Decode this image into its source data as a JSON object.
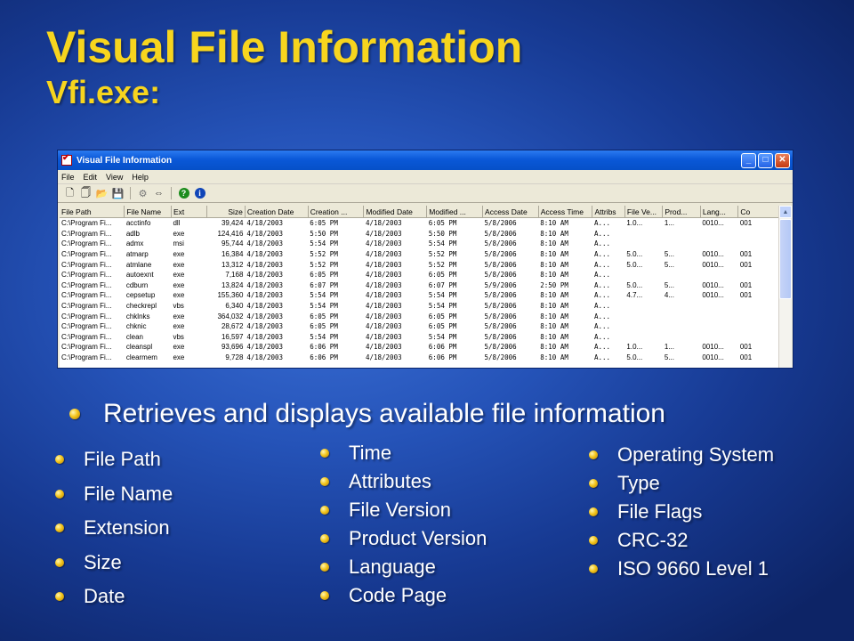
{
  "slide": {
    "title": "Visual File Information",
    "subtitle": "Vfi.exe:",
    "title_color": "#f7d51e",
    "main_bullet": "Retrieves and displays available file information",
    "bullets_col1": [
      "File Path",
      "File Name",
      "Extension",
      "Size",
      "Date"
    ],
    "bullets_col2": [
      "Time",
      "Attributes",
      "File Version",
      "Product Version",
      "Language",
      "Code Page"
    ],
    "bullets_col3": [
      "Operating System",
      "Type",
      "File Flags",
      "CRC-32",
      "ISO 9660 Level 1"
    ]
  },
  "window": {
    "title": "Visual File Information",
    "menu": [
      "File",
      "Edit",
      "View",
      "Help"
    ],
    "toolbar_icons": [
      "new-icon",
      "copy-icon",
      "open-icon",
      "save-icon",
      "tools-icon",
      "columns-icon",
      "help-icon",
      "info-icon"
    ],
    "columns": [
      "File Path",
      "File Name",
      "Ext",
      "Size",
      "Creation Date",
      "Creation ...",
      "Modified Date",
      "Modified ...",
      "Access Date",
      "Access Time",
      "Attribs",
      "File Ve...",
      "Prod...",
      "Lang...",
      "Co"
    ],
    "rows": [
      [
        "C:\\Program Fi...",
        "acctinfo",
        "dll",
        "39,424",
        "4/18/2003",
        "6:05 PM",
        "4/18/2003",
        "6:05 PM",
        "5/8/2006",
        "8:10 AM",
        "A...",
        "1.0...",
        "1...",
        "0010...",
        "001"
      ],
      [
        "C:\\Program Fi...",
        "adlb",
        "exe",
        "124,416",
        "4/18/2003",
        "5:50 PM",
        "4/18/2003",
        "5:50 PM",
        "5/8/2006",
        "8:10 AM",
        "A...",
        "",
        "",
        "",
        ""
      ],
      [
        "C:\\Program Fi...",
        "admx",
        "msi",
        "95,744",
        "4/18/2003",
        "5:54 PM",
        "4/18/2003",
        "5:54 PM",
        "5/8/2006",
        "8:10 AM",
        "A...",
        "",
        "",
        "",
        ""
      ],
      [
        "C:\\Program Fi...",
        "atmarp",
        "exe",
        "16,384",
        "4/18/2003",
        "5:52 PM",
        "4/18/2003",
        "5:52 PM",
        "5/8/2006",
        "8:10 AM",
        "A...",
        "5.0...",
        "5...",
        "0010...",
        "001"
      ],
      [
        "C:\\Program Fi...",
        "atmlane",
        "exe",
        "13,312",
        "4/18/2003",
        "5:52 PM",
        "4/18/2003",
        "5:52 PM",
        "5/8/2006",
        "8:10 AM",
        "A...",
        "5.0...",
        "5...",
        "0010...",
        "001"
      ],
      [
        "C:\\Program Fi...",
        "autoexnt",
        "exe",
        "7,168",
        "4/18/2003",
        "6:05 PM",
        "4/18/2003",
        "6:05 PM",
        "5/8/2006",
        "8:10 AM",
        "A...",
        "",
        "",
        "",
        ""
      ],
      [
        "C:\\Program Fi...",
        "cdburn",
        "exe",
        "13,824",
        "4/18/2003",
        "6:07 PM",
        "4/18/2003",
        "6:07 PM",
        "5/9/2006",
        "2:50 PM",
        "A...",
        "5.0...",
        "5...",
        "0010...",
        "001"
      ],
      [
        "C:\\Program Fi...",
        "cepsetup",
        "exe",
        "155,360",
        "4/18/2003",
        "5:54 PM",
        "4/18/2003",
        "5:54 PM",
        "5/8/2006",
        "8:10 AM",
        "A...",
        "4.7...",
        "4...",
        "0010...",
        "001"
      ],
      [
        "C:\\Program Fi...",
        "checkrepl",
        "vbs",
        "6,340",
        "4/18/2003",
        "5:54 PM",
        "4/18/2003",
        "5:54 PM",
        "5/8/2006",
        "8:10 AM",
        "A...",
        "",
        "",
        "",
        ""
      ],
      [
        "C:\\Program Fi...",
        "chklnks",
        "exe",
        "364,032",
        "4/18/2003",
        "6:05 PM",
        "4/18/2003",
        "6:05 PM",
        "5/8/2006",
        "8:10 AM",
        "A...",
        "",
        "",
        "",
        ""
      ],
      [
        "C:\\Program Fi...",
        "chknic",
        "exe",
        "28,672",
        "4/18/2003",
        "6:05 PM",
        "4/18/2003",
        "6:05 PM",
        "5/8/2006",
        "8:10 AM",
        "A...",
        "",
        "",
        "",
        ""
      ],
      [
        "C:\\Program Fi...",
        "clean",
        "vbs",
        "16,597",
        "4/18/2003",
        "5:54 PM",
        "4/18/2003",
        "5:54 PM",
        "5/8/2006",
        "8:10 AM",
        "A...",
        "",
        "",
        "",
        ""
      ],
      [
        "C:\\Program Fi...",
        "cleanspl",
        "exe",
        "93,696",
        "4/18/2003",
        "6:06 PM",
        "4/18/2003",
        "6:06 PM",
        "5/8/2006",
        "8:10 AM",
        "A...",
        "1.0...",
        "1...",
        "0010...",
        "001"
      ],
      [
        "C:\\Program Fi...",
        "clearmem",
        "exe",
        "9,728",
        "4/18/2003",
        "6:06 PM",
        "4/18/2003",
        "6:06 PM",
        "5/8/2006",
        "8:10 AM",
        "A...",
        "5.0...",
        "5...",
        "0010...",
        "001"
      ]
    ]
  }
}
